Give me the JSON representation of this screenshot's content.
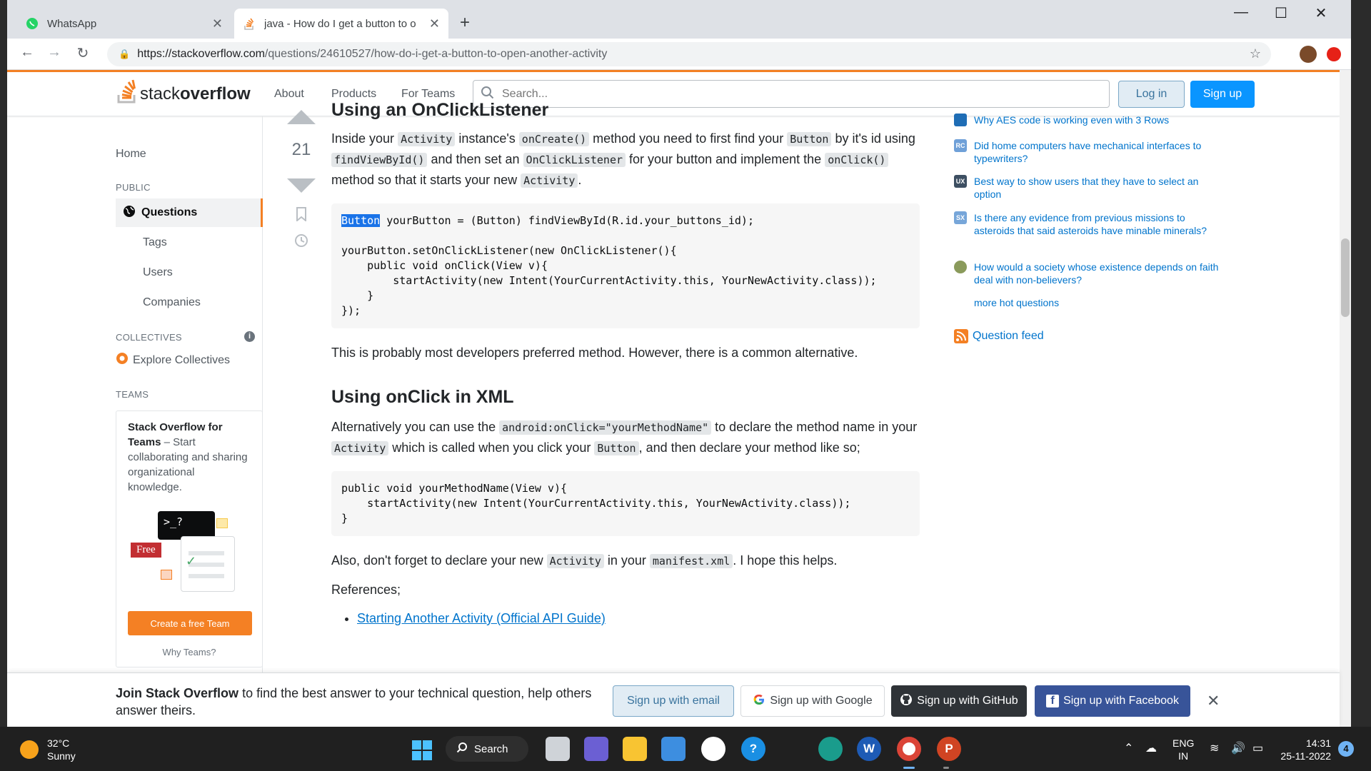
{
  "browser": {
    "tabs": [
      {
        "title": "WhatsApp",
        "active": false
      },
      {
        "title": "java - How do I get a button to o",
        "active": true
      }
    ],
    "url_host": "https://stackoverflow.com",
    "url_path": "/questions/24610527/how-do-i-get-a-button-to-open-another-activity"
  },
  "header": {
    "logo_light": "stack",
    "logo_bold": "overflow",
    "links": [
      "About",
      "Products",
      "For Teams"
    ],
    "search_placeholder": "Search...",
    "login": "Log in",
    "signup": "Sign up"
  },
  "left_nav": {
    "home": "Home",
    "section_public": "PUBLIC",
    "questions": "Questions",
    "tags": "Tags",
    "users": "Users",
    "companies": "Companies",
    "section_collectives": "COLLECTIVES",
    "explore_collectives": "Explore Collectives",
    "section_teams": "TEAMS",
    "teams_title": "Stack Overflow for Teams",
    "teams_desc": " – Start collaborating and sharing organizational knowledge.",
    "teams_free_badge": "Free",
    "teams_terminal": ">_?",
    "create_team": "Create a free Team",
    "why_teams": "Why Teams?"
  },
  "answer": {
    "score": "21",
    "heading1": "Using an OnClickListener",
    "p1_a": "Inside your ",
    "p1_code1": "Activity",
    "p1_b": " instance's ",
    "p1_code2": "onCreate()",
    "p1_c": " method you need to first find your ",
    "p1_code3": "Button",
    "p1_d": " by it's id using ",
    "p1_code4": "findViewById()",
    "p1_e": " and then set an ",
    "p1_code5": "OnClickListener",
    "p1_f": " for your button and implement the ",
    "p1_code6": "onClick()",
    "p1_g": " method so that it starts your new ",
    "p1_code7": "Activity",
    "p1_h": ".",
    "code1_hl": "Button",
    "code1_rest": " yourButton = (Button) findViewById(R.id.your_buttons_id);\n\nyourButton.setOnClickListener(new OnClickListener(){\n    public void onClick(View v){\n        startActivity(new Intent(YourCurrentActivity.this, YourNewActivity.class));\n    }\n});",
    "p2": "This is probably most developers preferred method. However, there is a common alternative.",
    "heading2": "Using onClick in XML",
    "p3_a": "Alternatively you can use the ",
    "p3_code1": "android:onClick=\"yourMethodName\"",
    "p3_b": " to declare the method name in your ",
    "p3_code2": "Activity",
    "p3_c": " which is called when you click your ",
    "p3_code3": "Button",
    "p3_d": ", and then declare your method like so;",
    "code2": "public void yourMethodName(View v){\n    startActivity(new Intent(YourCurrentActivity.this, YourNewActivity.class));\n}",
    "p4_a": "Also, don't forget to declare your new ",
    "p4_code1": "Activity",
    "p4_b": " in your ",
    "p4_code2": "manifest.xml",
    "p4_c": ". I hope this helps.",
    "references": "References;",
    "ref_link": "Starting Another Activity (Official API Guide)"
  },
  "hot_questions": {
    "items": [
      {
        "text": "Why AES code is working even with 3 Rows",
        "icon_color": "#1f6db5",
        "icon_label": ""
      },
      {
        "text": "Did home computers have mechanical interfaces to typewriters?",
        "icon_color": "#6fa0d8",
        "icon_label": "RC"
      },
      {
        "text": "Best way to show users that they have to select an option",
        "icon_color": "#3d4f62",
        "icon_label": "UX"
      },
      {
        "text": "Is there any evidence from previous missions to asteroids that said asteroids have minable minerals?",
        "icon_color": "#77a6d9",
        "icon_label": "SX"
      },
      {
        "text": "How would a society whose existence depends on faith deal with non-believers?",
        "icon_color": "#8a9a5b",
        "icon_label": ""
      }
    ],
    "more": "more hot questions",
    "feed": "Question feed"
  },
  "signup_banner": {
    "bold": "Join Stack Overflow",
    "text": " to find the best answer to your technical question, help others answer theirs.",
    "email": "Sign up with email",
    "google": "Sign up with Google",
    "github": "Sign up with GitHub",
    "facebook": "Sign up with Facebook"
  },
  "taskbar": {
    "temp": "32°C",
    "weather": "Sunny",
    "search": "Search",
    "lang1": "ENG",
    "lang2": "IN",
    "time": "14:31",
    "date": "25-11-2022",
    "notif_count": "4",
    "word_letter": "W",
    "ppt_letter": "P",
    "help_glyph": "?"
  }
}
